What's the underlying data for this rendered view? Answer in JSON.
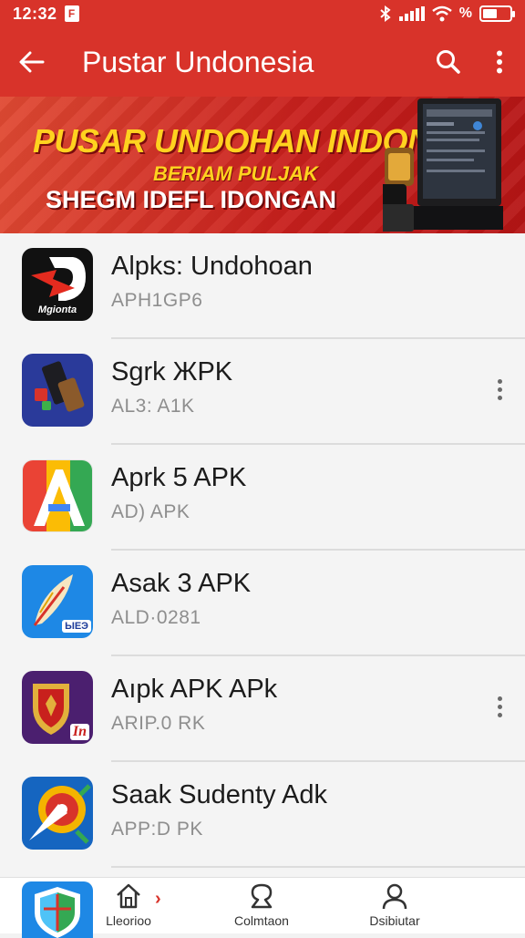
{
  "status_bar": {
    "time": "12:32",
    "notification_flag": "F",
    "percent_label": "%",
    "battery_level": 0.55
  },
  "app_bar": {
    "title": "Pustar Undonesia",
    "back_icon": "arrow-left-icon",
    "search_icon": "search-icon",
    "menu_icon": "more-vert-icon"
  },
  "banner": {
    "line1": "PUSAR UNDOHAN INDONSIA",
    "line2": "BERIAM PULJAK",
    "line3": "SHEGM IDEFL IDONGAN"
  },
  "apps": [
    {
      "title": "Alpks: Undohoan",
      "subtitle": "APH1GP6",
      "icon": "red-arrow-app-icon",
      "icon_label": "Mgionta",
      "has_menu": false
    },
    {
      "title": "Sgrk ЖPK",
      "subtitle": "AL3: A1K",
      "icon": "blue-tools-app-icon",
      "has_menu": true
    },
    {
      "title": "Aprk 5 APK",
      "subtitle": "AD) APK",
      "icon": "rainbow-a-app-icon",
      "has_menu": false
    },
    {
      "title": "Asak 3 APK",
      "subtitle": "ALD·0281",
      "icon": "blue-feather-app-icon",
      "icon_label": "ЫЕЭ",
      "has_menu": false
    },
    {
      "title": "Aıpk APK APk",
      "subtitle": "ARIP.0 RK",
      "icon": "purple-shield-app-icon",
      "icon_label": "In",
      "has_menu": true
    },
    {
      "title": "Saak Sudenty Adk",
      "subtitle": "APP:D PK",
      "icon": "colorful-rocket-app-icon",
      "has_menu": false
    }
  ],
  "bottom_nav": {
    "items": [
      {
        "label": "Lleorioo",
        "icon": "home-icon"
      },
      {
        "label": "Colmtaon",
        "icon": "community-icon"
      },
      {
        "label": "Dsibiutar",
        "icon": "profile-icon"
      }
    ],
    "chevron": "›"
  },
  "colors": {
    "primary": "#d8332a",
    "banner_yellow": "#ffd21f",
    "text_primary": "#1c1c1c",
    "text_secondary": "#8e8e8e"
  }
}
